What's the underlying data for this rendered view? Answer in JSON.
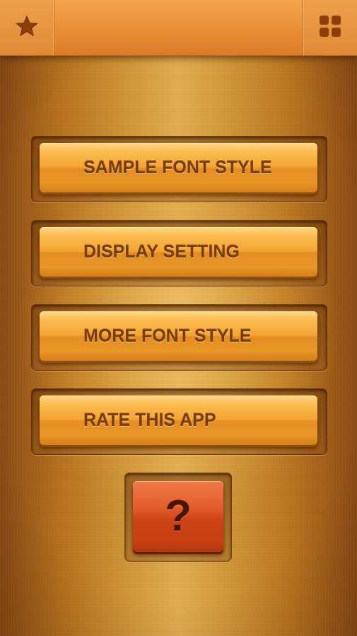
{
  "header": {
    "title": "",
    "left_icon": "star-icon",
    "right_icon": "grid-icon"
  },
  "menu": {
    "items": [
      {
        "id": "sample-font-style",
        "label": "SAMPLE FONT STYLE"
      },
      {
        "id": "display-setting",
        "label": "DISPLAY SETTING"
      },
      {
        "id": "more-font-style",
        "label": "MORE FONT STYLE"
      },
      {
        "id": "rate-this-app",
        "label": "RATE THIS APP"
      }
    ]
  },
  "help": {
    "label": "?",
    "icon": "question-mark-icon"
  },
  "colors": {
    "accent_orange": "#f3a534",
    "help_red": "#cc4318",
    "label_brown": "#7a3c08",
    "topbar": "#e58c34"
  }
}
